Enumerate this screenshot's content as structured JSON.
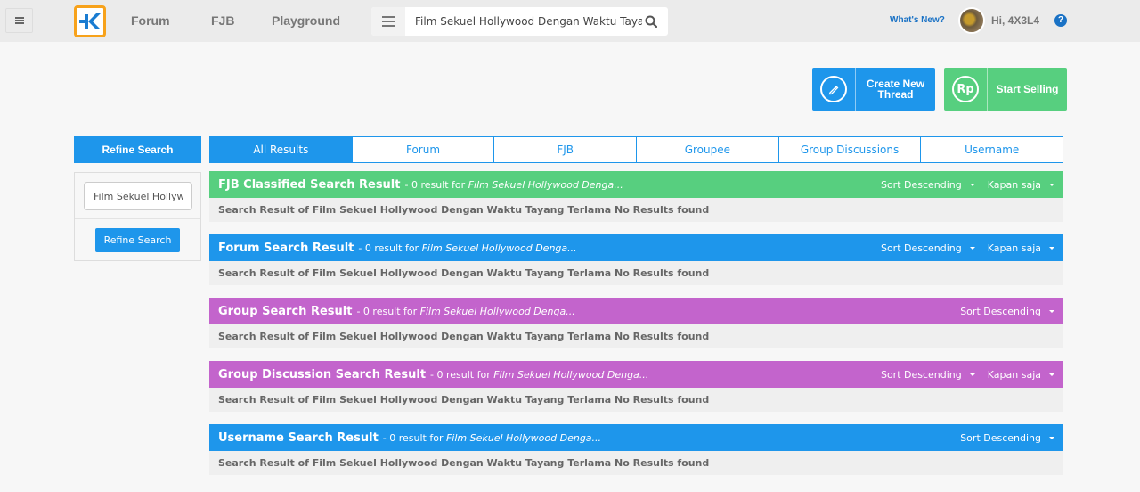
{
  "header": {
    "nav": [
      "Forum",
      "FJB",
      "Playground"
    ],
    "search_value": "Film Sekuel Hollywood Dengan Waktu Tayang Terlama",
    "whats_new": "What's New?",
    "greeting": "Hi, 4X3L4",
    "help": "?"
  },
  "actions": {
    "create_thread": [
      "Create New",
      "Thread"
    ],
    "start_selling": "Start Selling",
    "rp_icon": "Rp"
  },
  "sidebar": {
    "header": "Refine Search",
    "input_value": "Film Sekuel Hollywood Dengan Waktu Tayang Terlama",
    "button": "Refine Search"
  },
  "tabs": [
    {
      "label": "All Results",
      "active": true
    },
    {
      "label": "Forum",
      "active": false
    },
    {
      "label": "FJB",
      "active": false
    },
    {
      "label": "Groupee",
      "active": false
    },
    {
      "label": "Group Discussions",
      "active": false
    },
    {
      "label": "Username",
      "active": false
    }
  ],
  "results": [
    {
      "title": "FJB Classified Search Result",
      "meta": "- 0 result for",
      "query": "Film Sekuel Hollywood Denga...",
      "sort": "Sort Descending",
      "time": "Kapan saja",
      "body": "Search Result of Film Sekuel Hollywood Dengan Waktu Tayang Terlama No Results found",
      "color": "#57cf7f"
    },
    {
      "title": "Forum Search Result",
      "meta": "- 0 result for",
      "query": "Film Sekuel Hollywood Denga...",
      "sort": "Sort Descending",
      "time": "Kapan saja",
      "body": "Search Result of Film Sekuel Hollywood Dengan Waktu Tayang Terlama No Results found",
      "color": "#1e96eb"
    },
    {
      "title": "Group Search Result",
      "meta": "- 0 result for",
      "query": "Film Sekuel Hollywood Denga...",
      "sort": "Sort Descending",
      "time": null,
      "body": "Search Result of Film Sekuel Hollywood Dengan Waktu Tayang Terlama No Results found",
      "color": "#c364cc"
    },
    {
      "title": "Group Discussion Search Result",
      "meta": "- 0 result for",
      "query": "Film Sekuel Hollywood Denga...",
      "sort": "Sort Descending",
      "time": "Kapan saja",
      "body": "Search Result of Film Sekuel Hollywood Dengan Waktu Tayang Terlama No Results found",
      "color": "#c364cc"
    },
    {
      "title": "Username Search Result",
      "meta": "- 0 result for",
      "query": "Film Sekuel Hollywood Denga...",
      "sort": "Sort Descending",
      "time": null,
      "body": "Search Result of Film Sekuel Hollywood Dengan Waktu Tayang Terlama No Results found",
      "color": "#1e96eb"
    }
  ]
}
